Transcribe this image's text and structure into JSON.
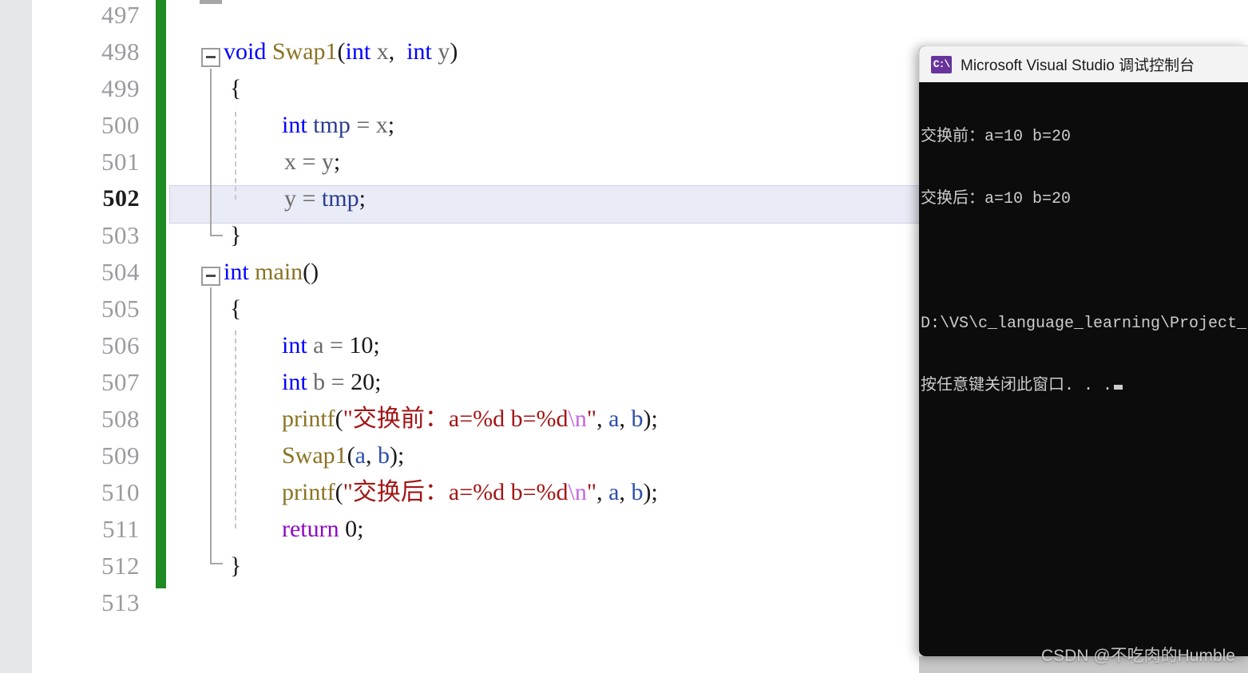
{
  "editor": {
    "line_numbers": [
      "497",
      "498",
      "499",
      "500",
      "501",
      "502",
      "503",
      "504",
      "505",
      "506",
      "507",
      "508",
      "509",
      "510",
      "511",
      "512",
      "513"
    ],
    "current_line": "502",
    "lines": [
      {
        "number": "497",
        "text": ""
      },
      {
        "number": "498",
        "text": "void Swap1(int x, int y)"
      },
      {
        "number": "499",
        "text": "{"
      },
      {
        "number": "500",
        "text": "    int tmp = x;"
      },
      {
        "number": "501",
        "text": "    x = y;"
      },
      {
        "number": "502",
        "text": "    y = tmp;"
      },
      {
        "number": "503",
        "text": "}"
      },
      {
        "number": "504",
        "text": "int main()"
      },
      {
        "number": "505",
        "text": "{"
      },
      {
        "number": "506",
        "text": "    int a = 10;"
      },
      {
        "number": "507",
        "text": "    int b = 20;"
      },
      {
        "number": "508",
        "text": "    printf(\"交换前：a=%d b=%d\\n\", a, b);"
      },
      {
        "number": "509",
        "text": "    Swap1(a, b);"
      },
      {
        "number": "510",
        "text": "    printf(\"交换后：a=%d b=%d\\n\", a, b);"
      },
      {
        "number": "511",
        "text": "    return 0;"
      },
      {
        "number": "512",
        "text": "}"
      },
      {
        "number": "513",
        "text": ""
      }
    ],
    "tokens": {
      "kw_void": "void",
      "kw_int": "int",
      "kw_return": "return",
      "fn_swap1": "Swap1",
      "fn_main": "main",
      "fn_printf": "printf",
      "id_x": "x",
      "id_y": "y",
      "id_tmp": "tmp",
      "id_a": "a",
      "id_b": "b",
      "num_10": "10",
      "num_20": "20",
      "num_0": "0",
      "str_before": "\"交换前：a=%d b=%d",
      "str_after": "\"交换后：a=%d b=%d",
      "esc_n": "\\n",
      "quote_close": "\"",
      "brace_open": "{",
      "brace_close": "}",
      "semicolon": ";",
      "equals": "=",
      "comma": ",",
      "paren_open": "(",
      "paren_close": ")"
    },
    "colors": {
      "keyword": "#0000ff",
      "keyword_control": "#8f08c4",
      "function": "#8a7323",
      "string": "#a31515",
      "escape": "#c266e0",
      "variable": "#2b4fa8",
      "identifier": "#6a6a6a",
      "line_number": "#9a9ba0",
      "change_bar_saved": "#1f8b24",
      "current_line_bg": "#e9ebf6"
    }
  },
  "console": {
    "title": "Microsoft Visual Studio 调试控制台",
    "icon_label": "C:\\",
    "output": [
      "交换前：a=10 b=20",
      "交换后：a=10 b=20",
      "",
      "D:\\VS\\c_language_learning\\Project_",
      "按任意键关闭此窗口. . ."
    ]
  },
  "watermark": {
    "text": "CSDN @不吃肉的Humble"
  }
}
